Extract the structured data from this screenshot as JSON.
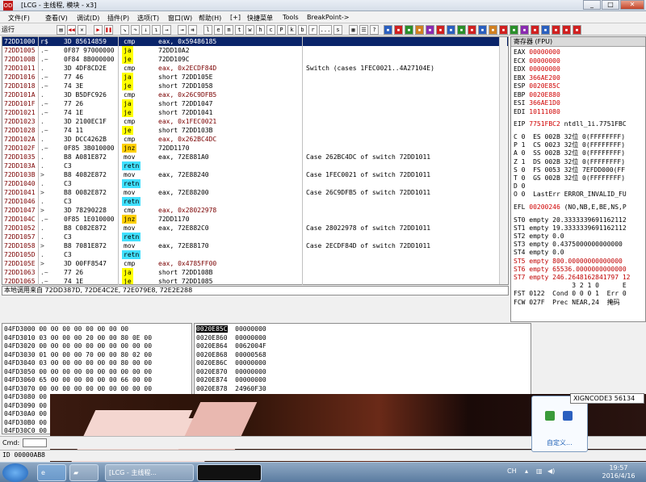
{
  "window": {
    "title": "[LCG - 主线程, 模块 - x3]",
    "app_icon_label": "OD"
  },
  "title_buttons": [
    "_",
    "□",
    "✕"
  ],
  "menu": [
    "文件(F)",
    "查看(V)",
    "调试(D)",
    "插件(P)",
    "选项(T)",
    "窗口(W)",
    "帮助(H)",
    "[+]",
    "快捷菜单",
    "Tools",
    "BreakPoint->"
  ],
  "toolbar": {
    "run_label": "运行",
    "letters": [
      "l",
      "e",
      "m",
      "t",
      "w",
      "h",
      "c",
      "P",
      "k",
      "b",
      "r",
      "...",
      "s"
    ]
  },
  "disasm_rows": [
    {
      "addr": "72DD1000",
      "mark": "r$",
      "bytes": "3D 85614859",
      "mnem": "cmp",
      "ops": "eax, 0x59486185",
      "cmt": "",
      "sel": true,
      "hl": ""
    },
    {
      "addr": "72DD1005",
      "mark": ".~",
      "bytes": "0F87 97000000",
      "mnem": "ja",
      "ops": "72DD10A2",
      "cmt": "",
      "hl": "y"
    },
    {
      "addr": "72DD100B",
      "mark": ".~",
      "bytes": "0F84 8B000000",
      "mnem": "je",
      "ops": "72DD109C",
      "cmt": "",
      "hl": "y"
    },
    {
      "addr": "72DD1011",
      "mark": ".",
      "bytes": "3D 4DF8CD2E",
      "mnem": "cmp",
      "ops": "eax, 0x2ECDF84D",
      "cmt": "Switch (cases 1FEC0021..4A27104E)",
      "hl": ""
    },
    {
      "addr": "72DD1016",
      "mark": ".~",
      "bytes": "77 46",
      "mnem": "ja",
      "ops": "short 72DD105E",
      "cmt": "",
      "hl": "y"
    },
    {
      "addr": "72DD1018",
      "mark": ".~",
      "bytes": "74 3E",
      "mnem": "je",
      "ops": "short 72DD1058",
      "cmt": "",
      "hl": "y"
    },
    {
      "addr": "72DD101A",
      "mark": ".",
      "bytes": "3D B5DFC926",
      "mnem": "cmp",
      "ops": "eax, 0x26C9DFB5",
      "cmt": "",
      "hl": ""
    },
    {
      "addr": "72DD101F",
      "mark": ".~",
      "bytes": "77 26",
      "mnem": "ja",
      "ops": "short 72DD1047",
      "cmt": "",
      "hl": "y"
    },
    {
      "addr": "72DD1021",
      "mark": ".~",
      "bytes": "74 1E",
      "mnem": "je",
      "ops": "short 72DD1041",
      "cmt": "",
      "hl": "y"
    },
    {
      "addr": "72DD1023",
      "mark": ".",
      "bytes": "3D 2100EC1F",
      "mnem": "cmp",
      "ops": "eax, 0x1FEC0021",
      "cmt": "",
      "hl": ""
    },
    {
      "addr": "72DD1028",
      "mark": ".~",
      "bytes": "74 11",
      "mnem": "je",
      "ops": "short 72DD103B",
      "cmt": "",
      "hl": "y"
    },
    {
      "addr": "72DD102A",
      "mark": ".",
      "bytes": "3D DCC4262B",
      "mnem": "cmp",
      "ops": "eax, 0x262BC4DC",
      "cmt": "",
      "hl": ""
    },
    {
      "addr": "72DD102F",
      "mark": ".~",
      "bytes": "0F85 3B010000",
      "mnem": "jnz",
      "ops": "72DD1170",
      "cmt": "",
      "hl": "o"
    },
    {
      "addr": "72DD1035",
      "mark": ".",
      "bytes": "B8 A081E872",
      "mnem": "mov",
      "ops": "eax, 72E881A0",
      "cmt": "Case 262BC4DC of switch 72DD1011",
      "hl": ""
    },
    {
      "addr": "72DD103A",
      "mark": ".",
      "bytes": "C3",
      "mnem": "retn",
      "ops": "",
      "cmt": "",
      "hl": "c"
    },
    {
      "addr": "72DD103B",
      "mark": ">",
      "bytes": "B8 4082E872",
      "mnem": "mov",
      "ops": "eax, 72E88240",
      "cmt": "Case 1FEC0021 of switch 72DD1011",
      "hl": ""
    },
    {
      "addr": "72DD1040",
      "mark": ".",
      "bytes": "C3",
      "mnem": "retn",
      "ops": "",
      "cmt": "",
      "hl": "c"
    },
    {
      "addr": "72DD1041",
      "mark": ">",
      "bytes": "B8 0082E872",
      "mnem": "mov",
      "ops": "eax, 72E88200",
      "cmt": "Case 26C9DFB5 of switch 72DD1011",
      "hl": ""
    },
    {
      "addr": "72DD1046",
      "mark": ".",
      "bytes": "C3",
      "mnem": "retn",
      "ops": "",
      "cmt": "",
      "hl": "c"
    },
    {
      "addr": "72DD1047",
      "mark": ">",
      "bytes": "3D 78290228",
      "mnem": "cmp",
      "ops": "eax, 0x28022978",
      "cmt": "",
      "hl": ""
    },
    {
      "addr": "72DD104C",
      "mark": ".~",
      "bytes": "0F85 1E010000",
      "mnem": "jnz",
      "ops": "72DD1170",
      "cmt": "",
      "hl": "o"
    },
    {
      "addr": "72DD1052",
      "mark": ".",
      "bytes": "B8 C082E872",
      "mnem": "mov",
      "ops": "eax, 72E882C0",
      "cmt": "Case 28022978 of switch 72DD1011",
      "hl": ""
    },
    {
      "addr": "72DD1057",
      "mark": ".",
      "bytes": "C3",
      "mnem": "retn",
      "ops": "",
      "cmt": "",
      "hl": "c"
    },
    {
      "addr": "72DD1058",
      "mark": ">",
      "bytes": "B8 7081E872",
      "mnem": "mov",
      "ops": "eax, 72E88170",
      "cmt": "Case 2ECDF84D of switch 72DD1011",
      "hl": ""
    },
    {
      "addr": "72DD105D",
      "mark": ".",
      "bytes": "C3",
      "mnem": "retn",
      "ops": "",
      "cmt": "",
      "hl": "c"
    },
    {
      "addr": "72DD105E",
      "mark": ">",
      "bytes": "3D 00FF8547",
      "mnem": "cmp",
      "ops": "eax, 0x4785FF00",
      "cmt": "",
      "hl": ""
    },
    {
      "addr": "72DD1063",
      "mark": ".~",
      "bytes": "77 26",
      "mnem": "ja",
      "ops": "short 72DD108B",
      "cmt": "",
      "hl": "y"
    },
    {
      "addr": "72DD1065",
      "mark": ".~",
      "bytes": "74 1E",
      "mnem": "je",
      "ops": "short 72DD1085",
      "cmt": "",
      "hl": "y"
    }
  ],
  "info_line": "本地调用来自 72DD387D, 72DE4C2E, 72E079E8, 72E2E288",
  "registers": {
    "header": "寄存器 (FPU)",
    "gp": [
      {
        "name": "EAX",
        "val": "00000000",
        "extra": ""
      },
      {
        "name": "ECX",
        "val": "00000000",
        "extra": ""
      },
      {
        "name": "EDX",
        "val": "00000000",
        "extra": ""
      },
      {
        "name": "EBX",
        "val": "366AE200",
        "extra": ""
      },
      {
        "name": "ESP",
        "val": "0020E85C",
        "extra": ""
      },
      {
        "name": "EBP",
        "val": "0020E880",
        "extra": ""
      },
      {
        "name": "ESI",
        "val": "366AE1D0",
        "extra": ""
      },
      {
        "name": "EDI",
        "val": "10111080",
        "extra": ""
      }
    ],
    "eip": {
      "name": "EIP",
      "val": "7751FBC2",
      "extra": "ntdll_1i.7751FBC"
    },
    "flags": [
      "C 0  ES 002B 32位 0(FFFFFFFF)",
      "P 1  CS 0023 32位 0(FFFFFFFF)",
      "A 0  SS 002B 32位 0(FFFFFFFF)",
      "Z 1  DS 002B 32位 0(FFFFFFFF)",
      "S 0  FS 0053 32位 7EFDD000(FF",
      "T 0  GS 002B 32位 0(FFFFFFFF)",
      "D 0",
      "O 0  LastErr ERROR_INVALID_FU"
    ],
    "efl": {
      "label": "EFL",
      "val": "00200246",
      "extra": "(NO,NB,E,BE,NS,P"
    },
    "fpu": [
      "ST0 empty 20.3333339691162112",
      "ST1 empty 19.3333339691162112",
      "ST2 empty 0.0",
      "ST3 empty 0.4375000000000000",
      "ST4 empty 0.0",
      "ST5 empty 800.00000000000000",
      "ST6 empty 65536.0000000000000",
      "ST7 empty 246.2648162841797 12"
    ],
    "fpu_tail": [
      "               3 2 1 0      E",
      "FST 0122  Cond 0 0 0 1  Err 0",
      "FCW 027F  Prec NEAR,24  掩码"
    ]
  },
  "dump_rows": [
    "04FD3000 00 00 00 00 00 00 00 00",
    "04FD3010 03 00 00 00 20 00 00 80 0E 00",
    "04FD3020 00 00 00 00 00 00 00 00 00 00",
    "04FD3030 01 00 00 00 70 00 00 80 02 00",
    "04FD3040 03 00 00 00 00 00 00 80 00 00",
    "04FD3050 00 00 00 00 00 00 00 00 00 00",
    "04FD3060 65 00 00 00 00 00 00 66 00 00",
    "04FD3070 00 00 00 00 00 00 00 00 00 00",
    "04FD3080 00 00 00 00 00 00 00 00 00 00",
    "04FD3090 00 00 00 00 00 00 00 00 00 00",
    "04FD30A0 00 00 00 00 00 00 00 00",
    "04FD30B0 00 00 00 00 00 00",
    "04FD30C0 00 00 00 00 00"
  ],
  "stack_rows": [
    {
      "addr": "0020E85C",
      "val": "00000000",
      "sel": true
    },
    {
      "addr": "0020E860",
      "val": "00000000",
      "sel": false
    },
    {
      "addr": "0020E864",
      "val": "0062004F",
      "sel": false
    },
    {
      "addr": "0020E868",
      "val": "00000568",
      "sel": false
    },
    {
      "addr": "0020E86C",
      "val": "00000000",
      "sel": false
    },
    {
      "addr": "0020E870",
      "val": "00000000",
      "sel": false
    },
    {
      "addr": "0020E874",
      "val": "00000000",
      "sel": false
    },
    {
      "addr": "0020E878",
      "val": "24960F30",
      "sel": false
    }
  ],
  "cmd": {
    "label": "Cmd:"
  },
  "status": "ID 00000AB8",
  "tooltip": "XIGNCODE3 56134",
  "popup": {
    "link": "自定义..."
  },
  "taskbar": {
    "tasks": [
      {
        "label": "[LCG - 主线程..."
      },
      {
        "label": ""
      }
    ],
    "tray_text": "CH",
    "time": "19:57",
    "date": "2016/4/16"
  }
}
